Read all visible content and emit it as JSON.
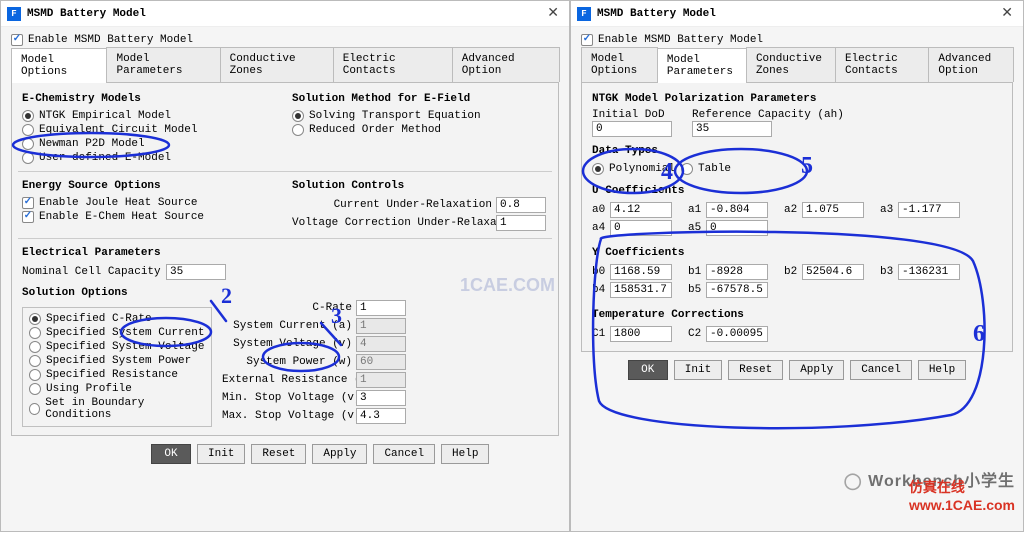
{
  "shared": {
    "window_title": "MSMD Battery Model",
    "enable_label": "Enable MSMD Battery Model",
    "tabs": [
      "Model Options",
      "Model Parameters",
      "Conductive Zones",
      "Electric Contacts",
      "Advanced Option"
    ],
    "buttons": {
      "ok": "OK",
      "init": "Init",
      "reset": "Reset",
      "apply": "Apply",
      "cancel": "Cancel",
      "help": "Help"
    }
  },
  "left": {
    "active_tab": "Model Options",
    "echem": {
      "title": "E-Chemistry Models",
      "options": [
        "NTGK Empirical Model",
        "Equivalent Circuit Model",
        "Newman P2D Model",
        "User-defined E-Model"
      ],
      "selected": 0
    },
    "sol_method": {
      "title": "Solution Method for E-Field",
      "options": [
        "Solving Transport Equation",
        "Reduced Order Method"
      ],
      "selected": 0
    },
    "energy_src": {
      "title": "Energy Source Options",
      "joule": "Enable Joule Heat Source",
      "echem_src": "Enable E-Chem Heat Source"
    },
    "sol_ctrl": {
      "title": "Solution Controls",
      "cur_label": "Current Under-Relaxation",
      "cur_val": "0.8",
      "vcor_label": "Voltage Correction Under-Relaxation",
      "vcor_val": "1"
    },
    "elec": {
      "title": "Electrical Parameters",
      "nominal_label": "Nominal Cell Capacity (ah)",
      "nominal_val": "35"
    },
    "sol_opts": {
      "title": "Solution Options",
      "options": [
        "Specified C-Rate",
        "Specified System Current",
        "Specified System Voltage",
        "Specified System Power",
        "Specified Resistance",
        "Using Profile",
        "Set in Boundary Conditions"
      ],
      "selected": 0,
      "crate_label": "C-Rate",
      "crate_val": "1",
      "sys_cur": {
        "label": "System Current  (a)",
        "val": "1"
      },
      "sys_v": {
        "label": "System Voltage  (v)",
        "val": "4"
      },
      "sys_p": {
        "label": "System Power  (w)",
        "val": "60"
      },
      "ext_r": {
        "label": "External Resistance  (ohm)",
        "val": "1"
      },
      "min_v": {
        "label": "Min. Stop Voltage  (v)",
        "val": "3"
      },
      "max_v": {
        "label": "Max. Stop Voltage  (v)",
        "val": "4.3"
      }
    }
  },
  "right": {
    "active_tab": "Model Parameters",
    "polar": {
      "title": "NTGK Model Polarization Parameters",
      "dod_label": "Initial DoD",
      "dod_val": "0",
      "refcap_label": "Reference Capacity (ah)",
      "refcap_val": "35"
    },
    "data_types": {
      "title": "Data Types",
      "options": [
        "Polynomial",
        "Table"
      ],
      "selected": 0
    },
    "u_title": "U Coefficients",
    "u": {
      "a0": "4.12",
      "a1": "-0.804",
      "a2": "1.075",
      "a3": "-1.177",
      "a4": "0",
      "a5": "0"
    },
    "y_title": "Y Coefficients",
    "y": {
      "b0": "1168.59",
      "b1": "-8928",
      "b2": "52504.6",
      "b3": "-136231",
      "b4": "158531.7",
      "b5": "-67578.5"
    },
    "tc_title": "Temperature Corrections",
    "tc": {
      "c1": "1800",
      "c2": "-0.00095"
    }
  },
  "watermarks": {
    "wb": "Workbench小学生",
    "site": "仿真在线",
    "url": "www.1CAE.com",
    "cae": "1CAE.COM"
  },
  "anno": {
    "n2": "2",
    "n3": "3",
    "n4": "4",
    "n5": "5",
    "n6": "6"
  },
  "chart_data": null
}
